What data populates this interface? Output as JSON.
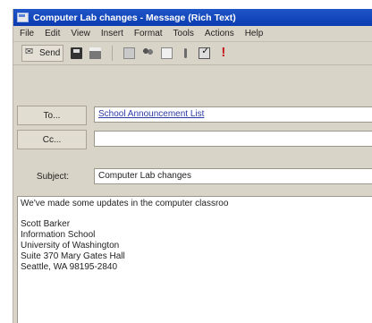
{
  "window": {
    "title": "Computer Lab changes - Message (Rich Text)"
  },
  "menu": [
    "File",
    "Edit",
    "View",
    "Insert",
    "Format",
    "Tools",
    "Actions",
    "Help"
  ],
  "toolbar": {
    "send_label": "Send"
  },
  "header": {
    "to_label": "To...",
    "to_value": "School Announcement List",
    "cc_label": "Cc...",
    "cc_value": "",
    "subject_label": "Subject:",
    "subject_value": "Computer Lab changes"
  },
  "body": {
    "first_line": "We've made some updates in the computer classroo",
    "signature": [
      "Scott Barker",
      "Information School",
      "University of Washington",
      "Suite 370 Mary Gates Hall",
      "Seattle, WA 98195-2840"
    ]
  }
}
